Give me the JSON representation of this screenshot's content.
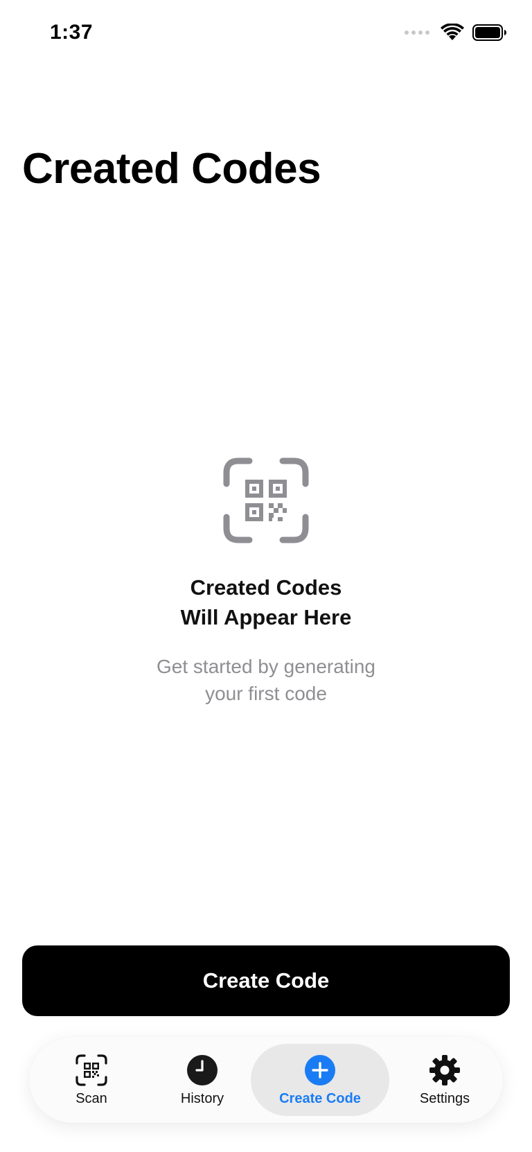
{
  "status_bar": {
    "time": "1:37"
  },
  "page": {
    "title": "Created Codes"
  },
  "empty_state": {
    "heading_line1": "Created Codes",
    "heading_line2": "Will Appear Here",
    "sub_line1": "Get started by generating",
    "sub_line2": "your first code",
    "icon": "qr-code-viewfinder-icon"
  },
  "primary_action": {
    "label": "Create Code"
  },
  "tab_bar": {
    "selected": "Create Code",
    "accent_color": "#1a7cf4",
    "items": [
      {
        "label": "Scan",
        "icon": "qr-scan-icon"
      },
      {
        "label": "History",
        "icon": "clock-icon"
      },
      {
        "label": "Create Code",
        "icon": "plus-circle-icon"
      },
      {
        "label": "Settings",
        "icon": "gear-icon"
      }
    ]
  }
}
